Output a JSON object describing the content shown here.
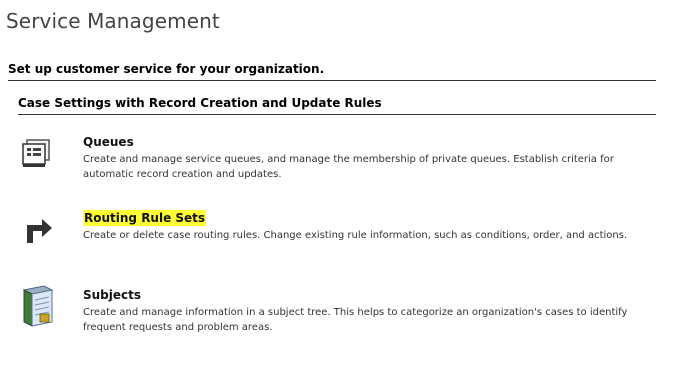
{
  "page": {
    "title": "Service Management"
  },
  "section": {
    "heading": "Set up customer service for your organization."
  },
  "group": {
    "heading": "Case Settings with Record Creation and Update Rules"
  },
  "items": [
    {
      "title": "Queues",
      "description": "Create and manage service queues, and manage the membership of private queues. Establish criteria for automatic record creation and updates.",
      "icon": "queue-icon"
    },
    {
      "title": "Routing Rule Sets",
      "description": "Create or delete case routing rules. Change existing rule information, such as conditions, order, and actions.",
      "icon": "routing-arrow-icon",
      "highlight_color": "#ffff33"
    },
    {
      "title": "Subjects",
      "description": "Create and manage information in a subject tree. This helps to categorize an organization's cases to identify frequent requests and problem areas.",
      "icon": "subject-book-icon"
    }
  ]
}
